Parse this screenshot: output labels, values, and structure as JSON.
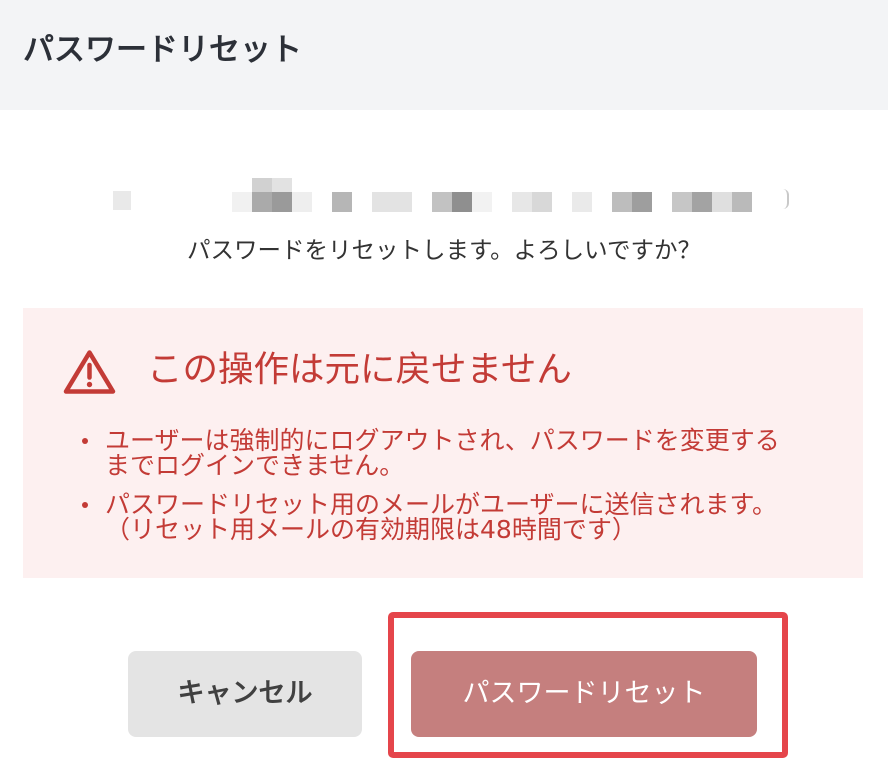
{
  "header": {
    "title": "パスワードリセット"
  },
  "body": {
    "confirm_message": "パスワードをリセットします。よろしいですか？",
    "warning": {
      "icon": "warning-triangle-icon",
      "title": "この操作は元に戻せません",
      "items": [
        {
          "lines": [
            "ユーザーは強制的にログアウトされ、パスワードを変更する",
            "までログインできません。"
          ]
        },
        {
          "lines": [
            "パスワードリセット用のメールがユーザーに送信されます。",
            "（リセット用メールの有効期限は48時間です）"
          ]
        }
      ]
    }
  },
  "footer": {
    "cancel_label": "キャンセル",
    "reset_label": "パスワードリセット"
  },
  "colors": {
    "header_background": "#f3f4f6",
    "accent": "#c33b36",
    "warning_background": "#fdf0f0",
    "secondary_button": "#e4e4e4",
    "danger_button": "#c57f7e",
    "highlight_border": "#e5454b"
  }
}
